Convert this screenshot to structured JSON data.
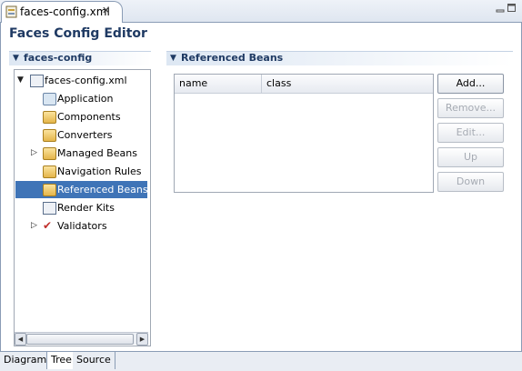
{
  "editor_tab": {
    "title": "faces-config.xml",
    "close_glyph": "✕"
  },
  "page_title": "Faces Config Editor",
  "left_section": {
    "title": "faces-config"
  },
  "right_section": {
    "title": "Referenced Beans"
  },
  "tree": {
    "root": "faces-config.xml",
    "items": [
      {
        "label": "Application",
        "icon": "application-icon",
        "expandable": false
      },
      {
        "label": "Components",
        "icon": "folder-icon",
        "expandable": false
      },
      {
        "label": "Converters",
        "icon": "folder-icon",
        "expandable": false
      },
      {
        "label": "Managed Beans",
        "icon": "folder-icon",
        "expandable": true
      },
      {
        "label": "Navigation Rules",
        "icon": "folder-icon",
        "expandable": false
      },
      {
        "label": "Referenced Beans",
        "icon": "folder-icon",
        "expandable": false,
        "selected": true
      },
      {
        "label": "Render Kits",
        "icon": "file-icon",
        "expandable": false
      },
      {
        "label": "Validators",
        "icon": "check-icon",
        "expandable": true
      }
    ]
  },
  "table": {
    "columns": [
      "name",
      "class"
    ],
    "rows": []
  },
  "buttons": {
    "add": "Add...",
    "remove": "Remove...",
    "edit": "Edit...",
    "up": "Up",
    "down": "Down"
  },
  "bottom_tabs": [
    "Diagram",
    "Tree",
    "Source"
  ],
  "active_bottom_tab": "Tree",
  "colors": {
    "selection": "#3f74b7",
    "header_text": "#1f3a63",
    "accent": "#8a9cb5"
  }
}
